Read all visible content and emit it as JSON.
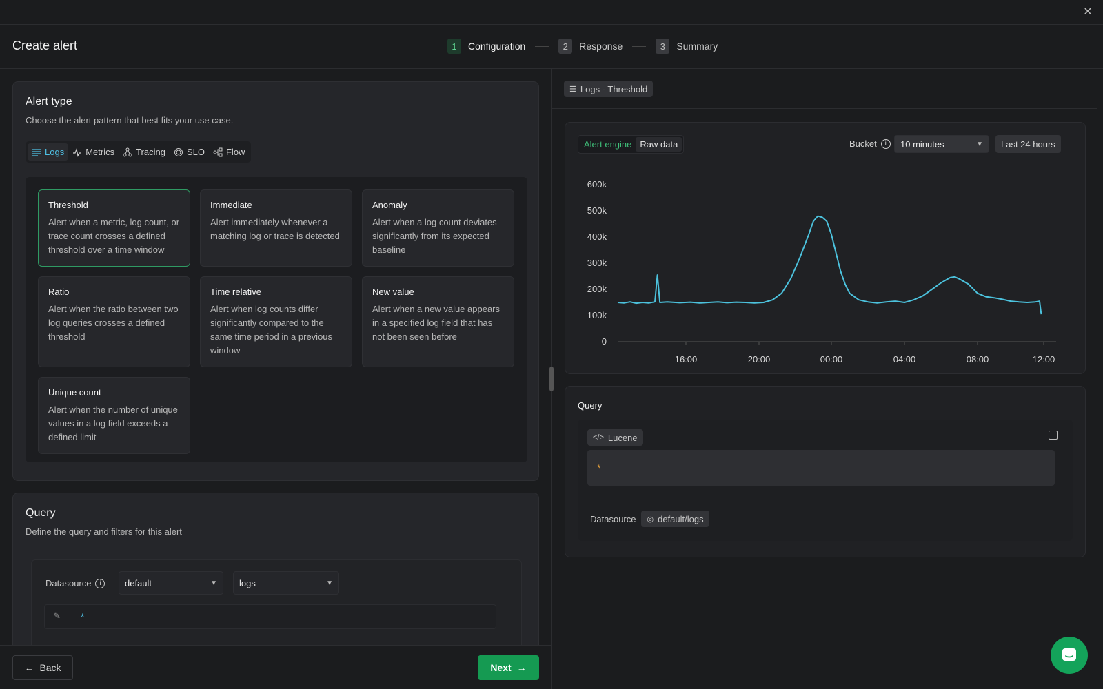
{
  "header": {
    "title": "Create alert",
    "steps": [
      {
        "num": "1",
        "label": "Configuration"
      },
      {
        "num": "2",
        "label": "Response"
      },
      {
        "num": "3",
        "label": "Summary"
      }
    ]
  },
  "alert_type": {
    "title": "Alert type",
    "subtitle": "Choose the alert pattern that best fits your use case.",
    "tabs": [
      "Logs",
      "Metrics",
      "Tracing",
      "SLO",
      "Flow"
    ],
    "cards": [
      {
        "title": "Threshold",
        "desc": "Alert when a metric, log count, or trace count crosses a defined threshold over a time window"
      },
      {
        "title": "Immediate",
        "desc": "Alert immediately whenever a matching log or trace is detected"
      },
      {
        "title": "Anomaly",
        "desc": "Alert when a log count deviates significantly from its expected baseline"
      },
      {
        "title": "Ratio",
        "desc": "Alert when the ratio between two log queries crosses a defined threshold"
      },
      {
        "title": "Time relative",
        "desc": "Alert when log counts differ significantly compared to the same time period in a previous window"
      },
      {
        "title": "New value",
        "desc": "Alert when a new value appears in a specified log field that has not been seen before"
      },
      {
        "title": "Unique count",
        "desc": "Alert when the number of unique values in a log field exceeds a defined limit"
      }
    ]
  },
  "query_section": {
    "title": "Query",
    "subtitle": "Define the query and filters for this alert",
    "datasource_label": "Datasource",
    "datasource_value": "default",
    "logs_value": "logs",
    "query_value": "*"
  },
  "footer": {
    "back": "Back",
    "next": "Next"
  },
  "preview": {
    "badge": "Logs - Threshold",
    "toggle": [
      "Alert engine",
      "Raw data"
    ],
    "bucket_label": "Bucket",
    "bucket_value": "10 minutes",
    "range": "Last 24 hours"
  },
  "chart_data": {
    "type": "line",
    "y_ticks": [
      "600k",
      "500k",
      "400k",
      "300k",
      "200k",
      "100k",
      "0"
    ],
    "x_ticks": [
      "16:00",
      "20:00",
      "00:00",
      "04:00",
      "08:00",
      "12:00"
    ],
    "ylim": [
      0,
      600000
    ],
    "series": [
      {
        "values": [
          [
            13.25,
            150000
          ],
          [
            13.5,
            148000
          ],
          [
            13.75,
            152000
          ],
          [
            14,
            147000
          ],
          [
            14.25,
            150000
          ],
          [
            14.5,
            148000
          ],
          [
            14.75,
            152000
          ],
          [
            14.85,
            255000
          ],
          [
            14.95,
            150000
          ],
          [
            15.25,
            152000
          ],
          [
            15.75,
            149000
          ],
          [
            16.25,
            151000
          ],
          [
            16.75,
            148000
          ],
          [
            17.25,
            150000
          ],
          [
            17.75,
            152000
          ],
          [
            18.25,
            149000
          ],
          [
            18.75,
            151000
          ],
          [
            19.25,
            150000
          ],
          [
            19.75,
            148000
          ],
          [
            20.25,
            150000
          ],
          [
            20.75,
            160000
          ],
          [
            21.25,
            185000
          ],
          [
            21.75,
            240000
          ],
          [
            22.25,
            320000
          ],
          [
            22.75,
            410000
          ],
          [
            23.0,
            460000
          ],
          [
            23.25,
            480000
          ],
          [
            23.5,
            475000
          ],
          [
            23.75,
            460000
          ],
          [
            24.0,
            410000
          ],
          [
            24.25,
            340000
          ],
          [
            24.5,
            270000
          ],
          [
            24.75,
            220000
          ],
          [
            25.0,
            185000
          ],
          [
            25.5,
            160000
          ],
          [
            26.0,
            152000
          ],
          [
            26.5,
            148000
          ],
          [
            27.0,
            152000
          ],
          [
            27.5,
            155000
          ],
          [
            28.0,
            150000
          ],
          [
            28.5,
            160000
          ],
          [
            29.0,
            175000
          ],
          [
            29.5,
            200000
          ],
          [
            30.0,
            225000
          ],
          [
            30.5,
            245000
          ],
          [
            30.75,
            248000
          ],
          [
            31.0,
            240000
          ],
          [
            31.5,
            220000
          ],
          [
            32.0,
            185000
          ],
          [
            32.5,
            172000
          ],
          [
            33.0,
            168000
          ],
          [
            33.5,
            162000
          ],
          [
            34.0,
            155000
          ],
          [
            34.5,
            152000
          ],
          [
            35.0,
            150000
          ],
          [
            35.5,
            152000
          ],
          [
            35.75,
            155000
          ],
          [
            35.85,
            105000
          ]
        ]
      }
    ],
    "grid": false
  },
  "query_preview": {
    "title": "Query",
    "lang": "Lucene",
    "code": "*",
    "datasource_label": "Datasource",
    "datasource_value": "default/logs"
  }
}
